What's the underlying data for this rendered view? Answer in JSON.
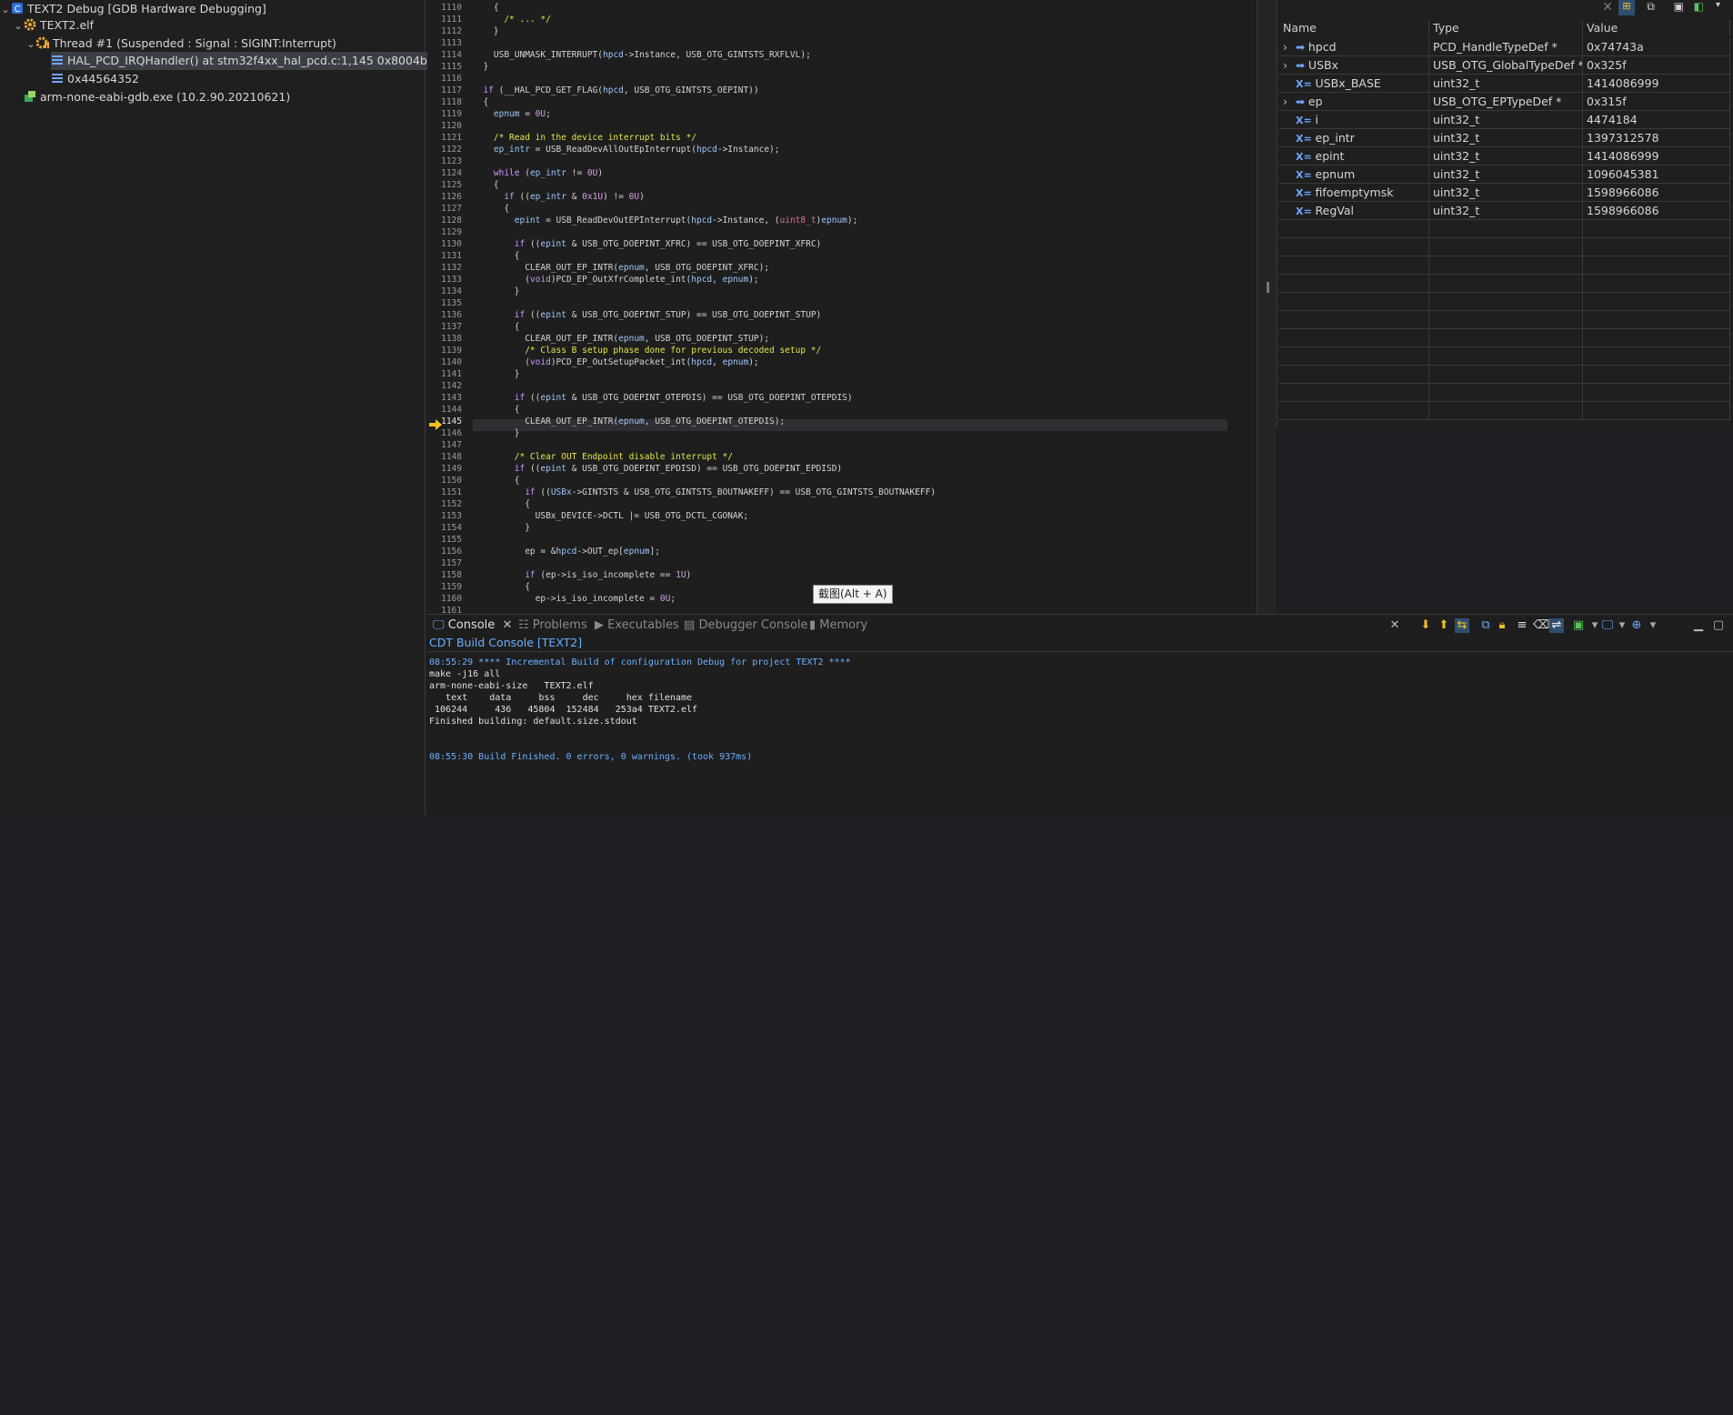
{
  "debug_tree": {
    "launch": "TEXT2 Debug [GDB Hardware Debugging]",
    "elf": "TEXT2.elf",
    "thread": "Thread #1 (Suspended : Signal : SIGINT:Interrupt)",
    "frame_selected": "HAL_PCD_IRQHandler() at stm32f4xx_hal_pcd.c:1,145 0x8004b3e",
    "frame_other": "0x44564352",
    "gdb": "arm-none-eabi-gdb.exe (10.2.90.20210621)"
  },
  "editor": {
    "current_line": "1145",
    "lines": [
      {
        "n": "1110",
        "t": "    {"
      },
      {
        "n": "1111",
        "t": "      /* ... */"
      },
      {
        "n": "1112",
        "t": "    }"
      },
      {
        "n": "1113",
        "t": ""
      },
      {
        "n": "1114",
        "t": "    USB_UNMASK_INTERRUPT(hpcd->Instance, USB_OTG_GINTSTS_RXFLVL);"
      },
      {
        "n": "1115",
        "t": "  }"
      },
      {
        "n": "1116",
        "t": ""
      },
      {
        "n": "1117",
        "t": "  if (__HAL_PCD_GET_FLAG(hpcd, USB_OTG_GINTSTS_OEPINT))"
      },
      {
        "n": "1118",
        "t": "  {"
      },
      {
        "n": "1119",
        "t": "    epnum = 0U;"
      },
      {
        "n": "1120",
        "t": ""
      },
      {
        "n": "1121",
        "t": "    /* Read in the device interrupt bits */"
      },
      {
        "n": "1122",
        "t": "    ep_intr = USB_ReadDevAllOutEpInterrupt(hpcd->Instance);"
      },
      {
        "n": "1123",
        "t": ""
      },
      {
        "n": "1124",
        "t": "    while (ep_intr != 0U)"
      },
      {
        "n": "1125",
        "t": "    {"
      },
      {
        "n": "1126",
        "t": "      if ((ep_intr & 0x1U) != 0U)"
      },
      {
        "n": "1127",
        "t": "      {"
      },
      {
        "n": "1128",
        "t": "        epint = USB_ReadDevOutEPInterrupt(hpcd->Instance, (uint8_t)epnum);"
      },
      {
        "n": "1129",
        "t": ""
      },
      {
        "n": "1130",
        "t": "        if ((epint & USB_OTG_DOEPINT_XFRC) == USB_OTG_DOEPINT_XFRC)"
      },
      {
        "n": "1131",
        "t": "        {"
      },
      {
        "n": "1132",
        "t": "          CLEAR_OUT_EP_INTR(epnum, USB_OTG_DOEPINT_XFRC);"
      },
      {
        "n": "1133",
        "t": "          (void)PCD_EP_OutXfrComplete_int(hpcd, epnum);"
      },
      {
        "n": "1134",
        "t": "        }"
      },
      {
        "n": "1135",
        "t": ""
      },
      {
        "n": "1136",
        "t": "        if ((epint & USB_OTG_DOEPINT_STUP) == USB_OTG_DOEPINT_STUP)"
      },
      {
        "n": "1137",
        "t": "        {"
      },
      {
        "n": "1138",
        "t": "          CLEAR_OUT_EP_INTR(epnum, USB_OTG_DOEPINT_STUP);"
      },
      {
        "n": "1139",
        "t": "          /* Class B setup phase done for previous decoded setup */"
      },
      {
        "n": "1140",
        "t": "          (void)PCD_EP_OutSetupPacket_int(hpcd, epnum);"
      },
      {
        "n": "1141",
        "t": "        }"
      },
      {
        "n": "1142",
        "t": ""
      },
      {
        "n": "1143",
        "t": "        if ((epint & USB_OTG_DOEPINT_OTEPDIS) == USB_OTG_DOEPINT_OTEPDIS)"
      },
      {
        "n": "1144",
        "t": "        {"
      },
      {
        "n": "1145",
        "t": "          CLEAR_OUT_EP_INTR(epnum, USB_OTG_DOEPINT_OTEPDIS);"
      },
      {
        "n": "1146",
        "t": "        }"
      },
      {
        "n": "1147",
        "t": ""
      },
      {
        "n": "1148",
        "t": "        /* Clear OUT Endpoint disable interrupt */"
      },
      {
        "n": "1149",
        "t": "        if ((epint & USB_OTG_DOEPINT_EPDISD) == USB_OTG_DOEPINT_EPDISD)"
      },
      {
        "n": "1150",
        "t": "        {"
      },
      {
        "n": "1151",
        "t": "          if ((USBx->GINTSTS & USB_OTG_GINTSTS_BOUTNAKEFF) == USB_OTG_GINTSTS_BOUTNAKEFF)"
      },
      {
        "n": "1152",
        "t": "          {"
      },
      {
        "n": "1153",
        "t": "            USBx_DEVICE->DCTL |= USB_OTG_DCTL_CGONAK;"
      },
      {
        "n": "1154",
        "t": "          }"
      },
      {
        "n": "1155",
        "t": ""
      },
      {
        "n": "1156",
        "t": "          ep = &hpcd->OUT_ep[epnum];"
      },
      {
        "n": "1157",
        "t": ""
      },
      {
        "n": "1158",
        "t": "          if (ep->is_iso_incomplete == 1U)"
      },
      {
        "n": "1159",
        "t": "          {"
      },
      {
        "n": "1160",
        "t": "            ep->is_iso_incomplete = 0U;"
      },
      {
        "n": "1161",
        "t": ""
      }
    ]
  },
  "tooltip": "截图(Alt + A)",
  "variables": {
    "headers": {
      "name": "Name",
      "type": "Type",
      "value": "Value"
    },
    "rows": [
      {
        "name": "hpcd",
        "type": "PCD_HandleTypeDef *",
        "value": "0x74743a",
        "kind": "pointer"
      },
      {
        "name": "USBx",
        "type": "USB_OTG_GlobalTypeDef *",
        "value": "0x325f",
        "kind": "pointer"
      },
      {
        "name": "USBx_BASE",
        "type": "uint32_t",
        "value": "1414086999",
        "kind": "scalar"
      },
      {
        "name": "ep",
        "type": "USB_OTG_EPTypeDef *",
        "value": "0x315f",
        "kind": "pointer"
      },
      {
        "name": "i",
        "type": "uint32_t",
        "value": "4474184",
        "kind": "scalar"
      },
      {
        "name": "ep_intr",
        "type": "uint32_t",
        "value": "1397312578",
        "kind": "scalar"
      },
      {
        "name": "epint",
        "type": "uint32_t",
        "value": "1414086999",
        "kind": "scalar"
      },
      {
        "name": "epnum",
        "type": "uint32_t",
        "value": "1096045381",
        "kind": "scalar"
      },
      {
        "name": "fifoemptymsk",
        "type": "uint32_t",
        "value": "1598966086",
        "kind": "scalar"
      },
      {
        "name": "RegVal",
        "type": "uint32_t",
        "value": "1598966086",
        "kind": "scalar"
      }
    ]
  },
  "console": {
    "tabs": [
      "Console",
      "Problems",
      "Executables",
      "Debugger Console",
      "Memory"
    ],
    "title": "CDT Build Console [TEXT2]",
    "lines": [
      {
        "t": "08:55:29 **** Incremental Build of configuration Debug for project TEXT2 ****",
        "blue": true
      },
      {
        "t": "make -j16 all",
        "blue": false
      },
      {
        "t": "arm-none-eabi-size   TEXT2.elf",
        "blue": false
      },
      {
        "t": "   text    data     bss     dec     hex filename",
        "blue": false
      },
      {
        "t": " 106244     436   45804  152484   253a4 TEXT2.elf",
        "blue": false
      },
      {
        "t": "Finished building: default.size.stdout",
        "blue": false
      },
      {
        "t": "",
        "blue": false
      },
      {
        "t": "",
        "blue": false
      },
      {
        "t": "08:55:30 Build Finished. 0 errors, 0 warnings. (took 937ms)",
        "blue": true
      }
    ]
  },
  "colors": {
    "accent": "#6fa8ff",
    "arrow": "#f0c020",
    "comment": "#e4e44a"
  }
}
